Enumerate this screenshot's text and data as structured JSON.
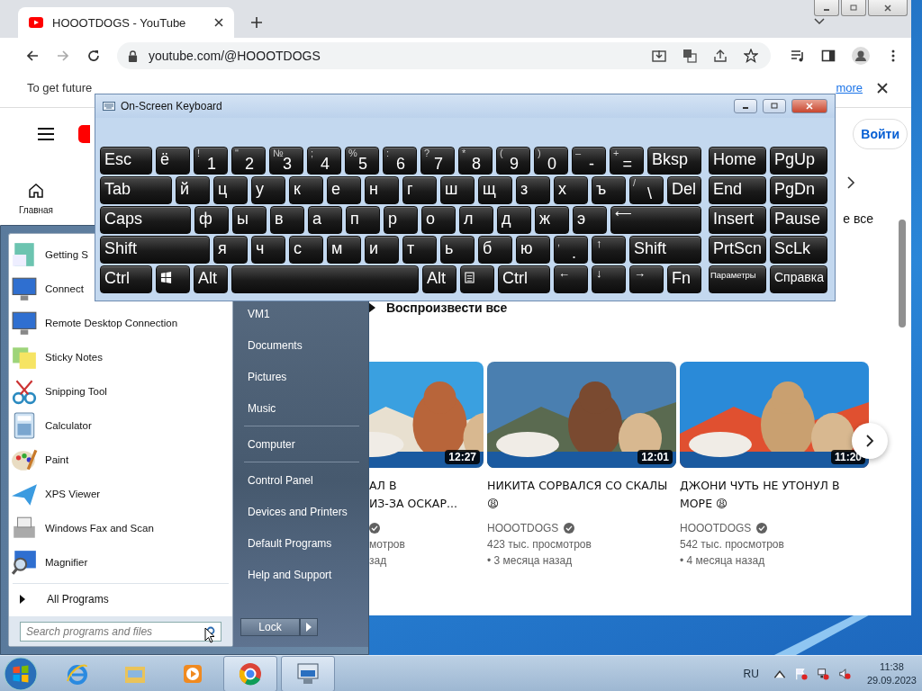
{
  "browser": {
    "tab_title": "HOOOTDOGS - YouTube",
    "url": "youtube.com/@HOOOTDOGS",
    "infobar": {
      "text": "To get future",
      "link": "more"
    }
  },
  "youtube": {
    "sign_in": "Войти",
    "home_label": "Главная",
    "row_fragment": "е все",
    "play_all": "Воспроизвести все",
    "videos": [
      {
        "kind": "partial",
        "title_lines": [
          "АЛ В",
          "ИЗ-ЗА ОСКАР..."
        ],
        "verified": true,
        "views": "мотров",
        "age": "зад",
        "duration": "12:27"
      },
      {
        "kind": "full",
        "title": "НИКИТА СОРВАЛСЯ СО СКАЛЫ 😩",
        "channel": "HOOOTDOGS",
        "verified": true,
        "views": "423 тыс. просмотров",
        "age": "• 3 месяца назад",
        "duration": "12:01"
      },
      {
        "kind": "full",
        "title": "ДЖОНИ ЧУТЬ НЕ УТОНУЛ В МОРЕ 😩",
        "channel": "HOOOTDOGS",
        "verified": true,
        "views": "542 тыс. просмотров",
        "age": "• 4 месяца назад",
        "duration": "11:20"
      }
    ]
  },
  "keyboard": {
    "title": "On-Screen Keyboard",
    "rows": [
      {
        "keys": [
          {
            "kind": "label",
            "label": "Esc"
          },
          {
            "kind": "label",
            "label": "ё"
          },
          {
            "kind": "dual",
            "top": "!",
            "label": "1"
          },
          {
            "kind": "dual",
            "top": "\"",
            "label": "2"
          },
          {
            "kind": "dual",
            "top": "№",
            "label": "3"
          },
          {
            "kind": "dual",
            "top": ";",
            "label": "4"
          },
          {
            "kind": "dual",
            "top": "%",
            "label": "5"
          },
          {
            "kind": "dual",
            "top": ":",
            "label": "6"
          },
          {
            "kind": "dual",
            "top": "?",
            "label": "7"
          },
          {
            "kind": "dual",
            "top": "*",
            "label": "8"
          },
          {
            "kind": "dual",
            "top": "(",
            "label": "9"
          },
          {
            "kind": "dual",
            "top": ")",
            "label": "0"
          },
          {
            "kind": "dual",
            "top": "–",
            "label": "-"
          },
          {
            "kind": "dual",
            "top": "+",
            "label": "="
          },
          {
            "kind": "label",
            "label": "Bksp"
          }
        ]
      },
      {
        "keys": [
          {
            "kind": "label",
            "label": "Tab"
          },
          {
            "kind": "label",
            "label": "й"
          },
          {
            "kind": "label",
            "label": "ц"
          },
          {
            "kind": "label",
            "label": "у"
          },
          {
            "kind": "label",
            "label": "к"
          },
          {
            "kind": "label",
            "label": "е"
          },
          {
            "kind": "label",
            "label": "н"
          },
          {
            "kind": "label",
            "label": "г"
          },
          {
            "kind": "label",
            "label": "ш"
          },
          {
            "kind": "label",
            "label": "щ"
          },
          {
            "kind": "label",
            "label": "з"
          },
          {
            "kind": "label",
            "label": "х"
          },
          {
            "kind": "label",
            "label": "ъ"
          },
          {
            "kind": "dual",
            "top": "/",
            "label": "\\"
          },
          {
            "kind": "label",
            "label": "Del"
          }
        ]
      },
      {
        "keys": [
          {
            "kind": "label",
            "label": "Caps"
          },
          {
            "kind": "label",
            "label": "ф"
          },
          {
            "kind": "label",
            "label": "ы"
          },
          {
            "kind": "label",
            "label": "в"
          },
          {
            "kind": "label",
            "label": "а"
          },
          {
            "kind": "label",
            "label": "п"
          },
          {
            "kind": "label",
            "label": "р"
          },
          {
            "kind": "label",
            "label": "о"
          },
          {
            "kind": "label",
            "label": "л"
          },
          {
            "kind": "label",
            "label": "д"
          },
          {
            "kind": "label",
            "label": "ж"
          },
          {
            "kind": "label",
            "label": "э"
          },
          {
            "kind": "small",
            "label": "⟵"
          }
        ]
      },
      {
        "keys": [
          {
            "kind": "label",
            "label": "Shift"
          },
          {
            "kind": "label",
            "label": "я"
          },
          {
            "kind": "label",
            "label": "ч"
          },
          {
            "kind": "label",
            "label": "с"
          },
          {
            "kind": "label",
            "label": "м"
          },
          {
            "kind": "label",
            "label": "и"
          },
          {
            "kind": "label",
            "label": "т"
          },
          {
            "kind": "label",
            "label": "ь"
          },
          {
            "kind": "label",
            "label": "б"
          },
          {
            "kind": "label",
            "label": "ю"
          },
          {
            "kind": "dual",
            "top": ",",
            "label": "."
          },
          {
            "kind": "small",
            "label": "↑"
          },
          {
            "kind": "label",
            "label": "Shift"
          }
        ]
      },
      {
        "keys": [
          {
            "kind": "label",
            "label": "Ctrl"
          },
          {
            "kind": "win"
          },
          {
            "kind": "label",
            "label": "Alt"
          },
          {
            "kind": "space"
          },
          {
            "kind": "label",
            "label": "Alt"
          },
          {
            "kind": "menu"
          },
          {
            "kind": "label",
            "label": "Ctrl"
          },
          {
            "kind": "small",
            "label": "←"
          },
          {
            "kind": "small",
            "label": "↓"
          },
          {
            "kind": "small",
            "label": "→"
          },
          {
            "kind": "label",
            "label": "Fn"
          }
        ]
      }
    ],
    "side_rows": [
      {
        "keys": [
          {
            "kind": "label",
            "label": "Home"
          },
          {
            "kind": "label",
            "label": "PgUp"
          }
        ]
      },
      {
        "keys": [
          {
            "kind": "label",
            "label": "End"
          },
          {
            "kind": "label",
            "label": "PgDn"
          }
        ]
      },
      {
        "keys": [
          {
            "kind": "label",
            "label": "Insert"
          },
          {
            "kind": "label",
            "label": "Pause"
          }
        ]
      },
      {
        "keys": [
          {
            "kind": "label",
            "label": "PrtScn"
          },
          {
            "kind": "label",
            "label": "ScLk"
          }
        ]
      },
      {
        "keys": [
          {
            "kind": "tiny",
            "label": "Параметры"
          },
          {
            "kind": "medium",
            "label": "Справка"
          }
        ]
      }
    ]
  },
  "start_menu": {
    "programs": [
      "Getting S",
      "Connect",
      "Remote Desktop Connection",
      "Sticky Notes",
      "Snipping Tool",
      "Calculator",
      "Paint",
      "XPS Viewer",
      "Windows Fax and Scan",
      "Magnifier"
    ],
    "all_programs": "All Programs",
    "search_placeholder": "Search programs and files",
    "places": [
      [
        "VM1",
        "Documents",
        "Pictures",
        "Music"
      ],
      [
        "Computer"
      ],
      [
        "Control Panel",
        "Devices and Printers",
        "Default Programs",
        "Help and Support"
      ]
    ],
    "shutdown": "Lock"
  },
  "taskbar": {
    "apps": [
      {
        "kind": "ie",
        "active": false
      },
      {
        "kind": "folder",
        "active": false
      },
      {
        "kind": "media",
        "active": false
      },
      {
        "kind": "chrome",
        "active": true
      },
      {
        "kind": "keyboard",
        "active": true
      }
    ],
    "language": "RU",
    "time": "11:38",
    "date": "29.09.2023"
  }
}
